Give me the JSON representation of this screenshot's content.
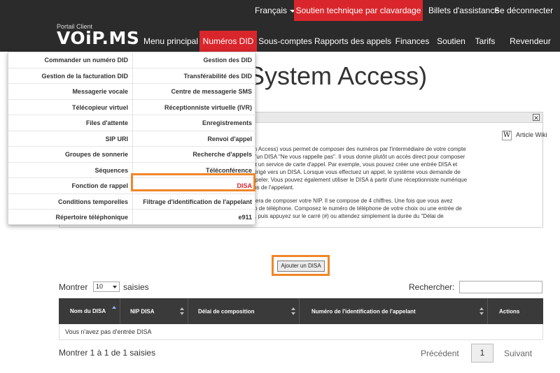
{
  "topbar": {
    "language": "Français",
    "support_button": "Soutien technique par clavardage",
    "tickets_link": "Billets d'assistance",
    "logout_link": "Se déconnecter",
    "logo_subtitle": "Portail Client",
    "logo_text": "VOiP.MS"
  },
  "nav": {
    "items": [
      {
        "label": "Menu principal"
      },
      {
        "label": "Numéros DID"
      },
      {
        "label": "Sous-comptes"
      },
      {
        "label": "Rapports des appels"
      },
      {
        "label": "Finances"
      },
      {
        "label": "Soutien"
      },
      {
        "label": "Tarifs"
      },
      {
        "label": "Revendeur"
      }
    ],
    "active_index": 1
  },
  "page": {
    "title_partial": "d System Access)"
  },
  "info_panel": {
    "wiki_label": "Article Wiki",
    "lines": [
      "em Access) vous permet de composer des numéros par l'intermédiaire de votre compte",
      "qu'un DISA \"Ne vous rappelle pas\". Il vous donne plutôt un accès direct pour composer",
      "fait un service de carte d'appel. Par exemple, vous pouvez créer une entrée DISA et",
      "t dirigé vers un DISA. Lorsque vous effectuez un appel, le système vous demande de",
      "appeler. Vous pouvez également utiliser le DISA à partir d'une réceptionniste numérique",
      "ions de l'appelant.",
      "ndera de composer votre NIP. Il se compose de 4 chiffres. Une fois que vous avez",
      "éro de téléphone. Composez le numéro de téléphone de votre choix ou une entrée de",
      "X), puis appuyez sur le carré (#) ou attendez simplement la durée du \"Délai de"
    ]
  },
  "did_menu": {
    "left": [
      "Commander un numéro DID",
      "Gestion de la facturation DID",
      "Messagerie vocale",
      "Télécopieur virtuel",
      "Files d'attente",
      "SIP URI",
      "Groupes de sonnerie",
      "Séquences",
      "Fonction de rappel",
      "Conditions temporelles",
      "Répertoire téléphonique"
    ],
    "right": [
      "Gestion des DID",
      "Transférabilité des DID",
      "Centre de messagerie SMS",
      "Réceptionniste virtuelle (IVR)",
      "Enregistrements",
      "Renvoi d'appel",
      "Recherche d'appels",
      "Téléconférence",
      "DISA",
      "Filtrage d'identification de l'appelant",
      "e911"
    ],
    "highlighted": "DISA"
  },
  "add_button": "Ajouter un DISA",
  "table_controls": {
    "show_prefix": "Montrer",
    "entries_value": "10",
    "show_suffix": "saisies",
    "search_label": "Rechercher:",
    "search_value": ""
  },
  "table": {
    "columns": [
      "Nom du DISA",
      "NIP DISA",
      "Délai de composition",
      "Numéro de l'identification de l'appelant",
      "Actions"
    ],
    "empty_message": "Vous n'avez pas d'entrée DISA"
  },
  "footer": {
    "info": "Montrer 1 à 1 de 1 saisies",
    "previous": "Précédent",
    "page": "1",
    "next": "Suivant"
  },
  "colors": {
    "accent_red": "#d9262c",
    "highlight_orange": "#f0862a",
    "header_dark": "#2b2b2b",
    "table_header": "#3a3a3a"
  }
}
